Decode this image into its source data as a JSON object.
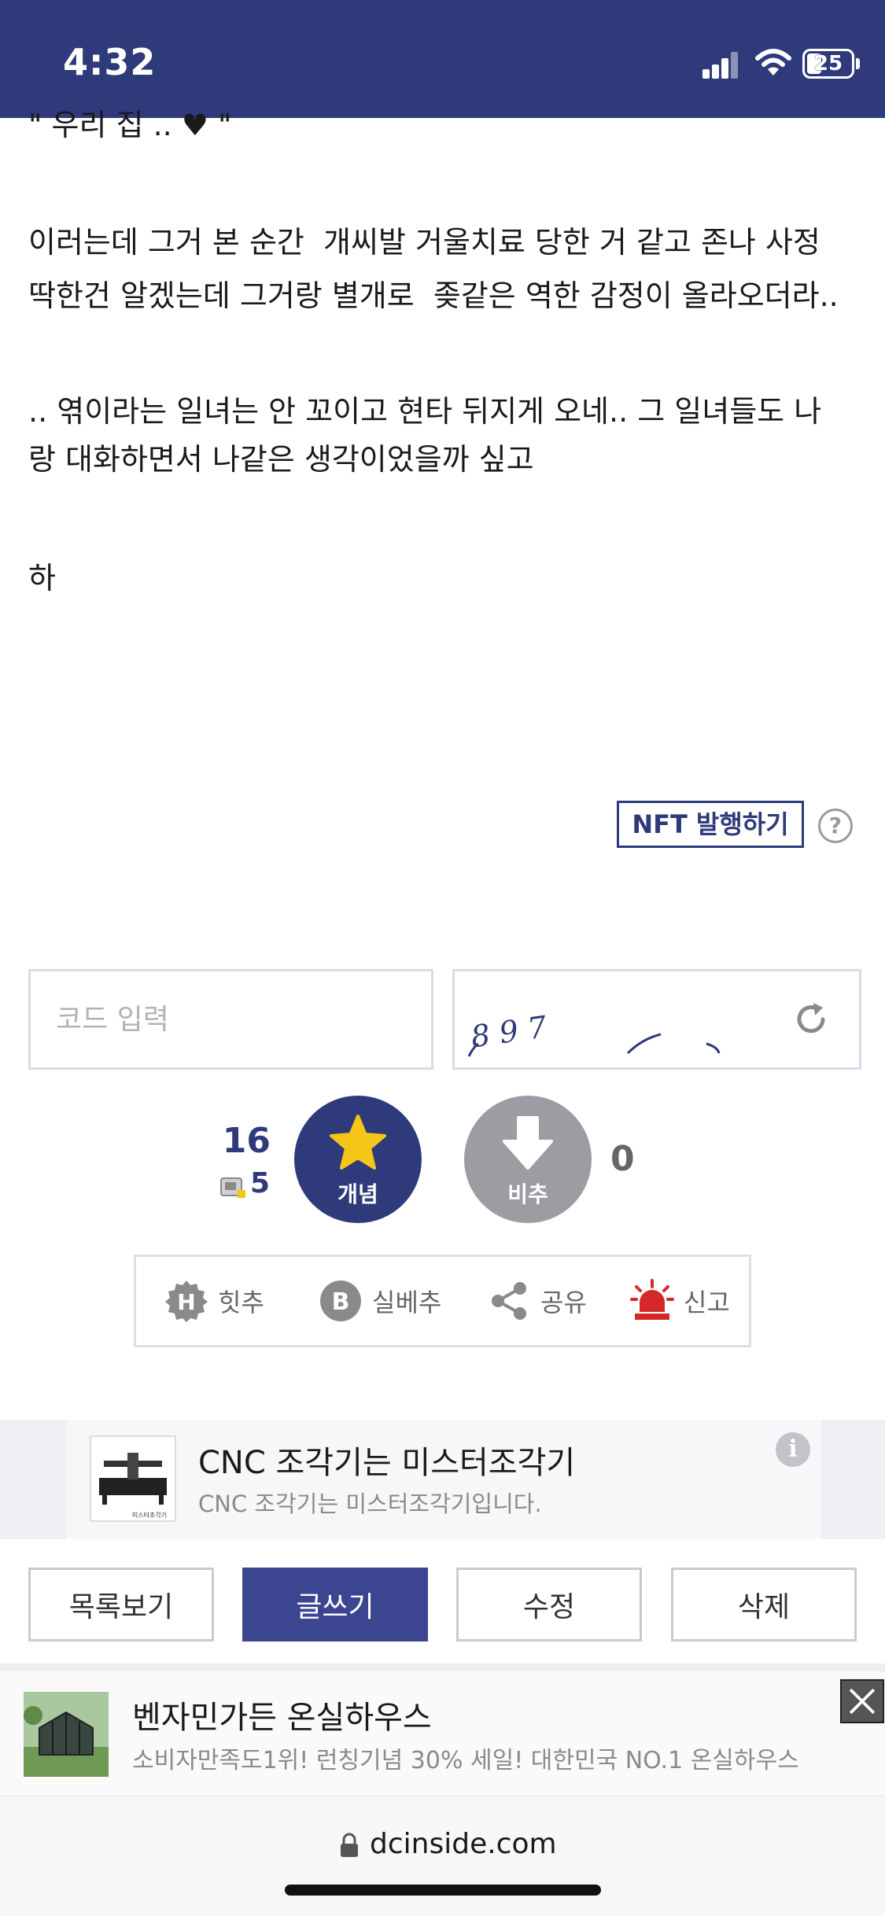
{
  "status_bar": {
    "time": "4:32",
    "battery": "25"
  },
  "post": {
    "lines": [
      "\" 우리 집 .. ♥ \"",
      "이러는데 그거 본 순간  개씨발 거울치료 당한 거 같고 존나 사정",
      "딱한건 알겠는데 그거랑 별개로  좆같은 역한 감정이 올라오더라..",
      ".. 엮이라는 일녀는 안 꼬이고 현타 뒤지게 오네.. 그 일녀들도 나",
      "랑 대화하면서 나같은 생각이었을까 싶고",
      "하"
    ]
  },
  "nft": {
    "label": "NFT 발행하기",
    "help": "?"
  },
  "captcha": {
    "placeholder": "코드 입력",
    "code": "8 9 7"
  },
  "votes": {
    "up_count": "16",
    "fixed_count": "5",
    "up_label": "개념",
    "down_label": "비추",
    "down_count": "0"
  },
  "actions": {
    "hit": "힛추",
    "best": "실베추",
    "share": "공유",
    "report": "신고"
  },
  "ad1": {
    "title": "CNC 조각기는 미스터조각기",
    "desc": "CNC 조각기는 미스터조각기입니다.",
    "thumb_caption": "미스터조각기",
    "info": "i"
  },
  "buttons": {
    "list": "목록보기",
    "write": "글쓰기",
    "edit": "수정",
    "delete": "삭제"
  },
  "ad2": {
    "title": "벤자민가든 온실하우스",
    "desc": "소비자만족도1위! 런칭기념 30% 세일! 대한민국 NO.1 온실하우스"
  },
  "url_bar": {
    "domain": "dcinside.com"
  },
  "colors": {
    "brand": "#2f3a7a",
    "star": "#f5c518",
    "report": "#d62828"
  }
}
